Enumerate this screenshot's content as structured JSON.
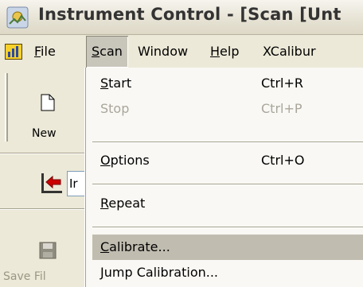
{
  "window": {
    "title": "Instrument Control - [Scan [Unt",
    "icon": "spectrum-app-icon"
  },
  "menubar": {
    "items": [
      {
        "label": "File",
        "key": "F",
        "rest": "ile"
      },
      {
        "label": "Scan",
        "key": "S",
        "rest": "can"
      },
      {
        "label": "Window",
        "key": "",
        "rest": "Window"
      },
      {
        "label": "Help",
        "key": "H",
        "rest": "elp"
      },
      {
        "label": "XCalibur",
        "key": "",
        "rest": "XCalibur"
      }
    ]
  },
  "toolbar": {
    "new_label": "New",
    "input_value": "Ir",
    "save_label": "Save Fil"
  },
  "scan_menu": {
    "items": [
      {
        "key": "S",
        "rest": "tart",
        "shortcut": "Ctrl+R",
        "enabled": true
      },
      {
        "key": "",
        "rest": "Stop",
        "shortcut": "Ctrl+P",
        "enabled": false
      },
      {
        "key": "O",
        "rest": "ptions",
        "shortcut": "Ctrl+O",
        "enabled": true
      },
      {
        "key": "R",
        "rest": "epeat",
        "shortcut": "",
        "enabled": true
      },
      {
        "key": "C",
        "rest": "alibrate...",
        "shortcut": "",
        "enabled": true,
        "highlighted": true
      },
      {
        "key": "J",
        "rest": "ump Calibration...",
        "shortcut": "",
        "enabled": true
      }
    ]
  },
  "colors": {
    "menu_highlight": "#c0bcb0",
    "disabled_text": "#a9a69a",
    "accent_red": "#cc0000"
  }
}
